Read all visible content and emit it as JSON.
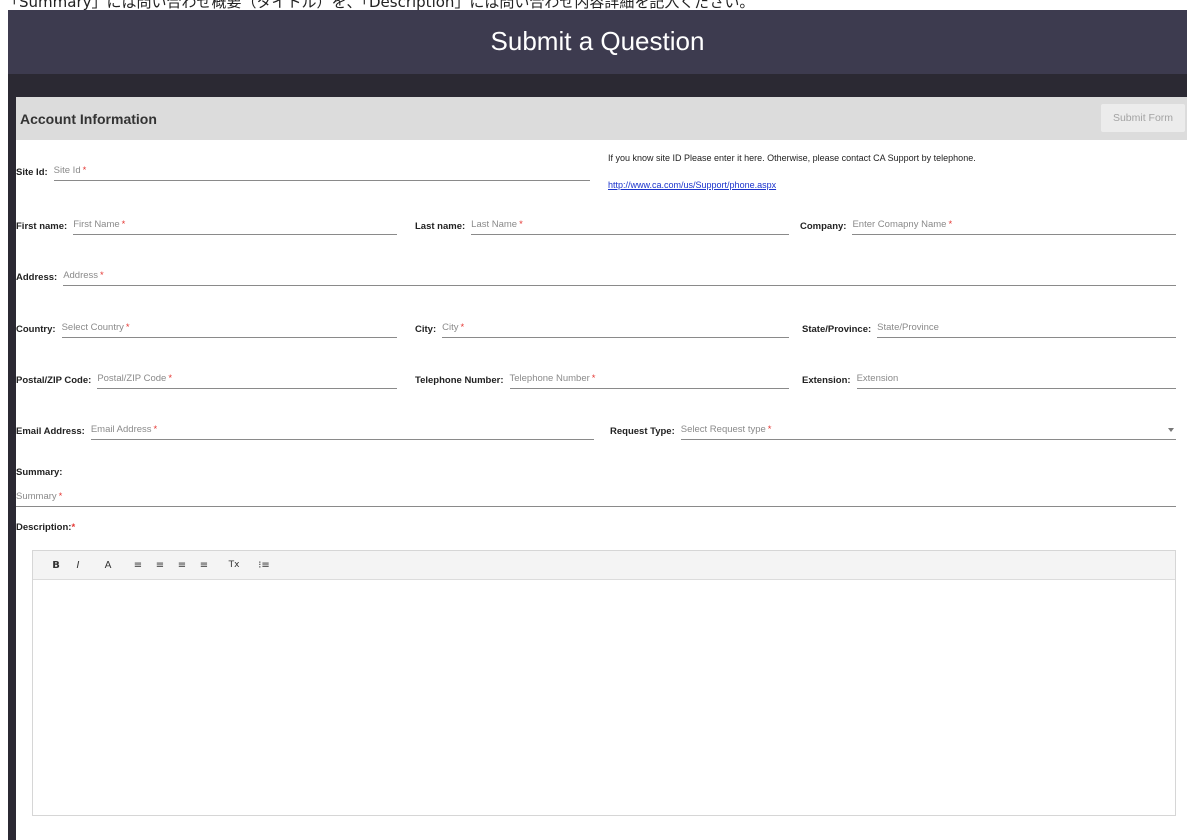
{
  "caption": "「Summary」には問い合わせ概要（タイトル）を、「Description」には問い合わせ内容詳細を記入ください。",
  "header": {
    "title": "Submit a Question"
  },
  "section": {
    "title": "Account Information",
    "submit_label": "Submit Form"
  },
  "fields": {
    "site_id": {
      "label": "Site Id:",
      "placeholder": "Site Id",
      "required": "*"
    },
    "site_info": "If you know site ID Please enter it here. Otherwise, please contact CA Support by telephone.",
    "site_link": "http://www.ca.com/us/Support/phone.aspx",
    "first_name": {
      "label": "First name:",
      "placeholder": "First Name",
      "required": "*"
    },
    "last_name": {
      "label": "Last name:",
      "placeholder": "Last Name",
      "required": "*"
    },
    "company": {
      "label": "Company:",
      "placeholder": "Enter Comapny Name",
      "required": "*"
    },
    "address": {
      "label": "Address:",
      "placeholder": "Address",
      "required": "*"
    },
    "country": {
      "label": "Country:",
      "placeholder": "Select Country",
      "required": "*"
    },
    "city": {
      "label": "City:",
      "placeholder": "City",
      "required": "*"
    },
    "state": {
      "label": "State/Province:",
      "placeholder": "State/Province"
    },
    "postal": {
      "label": "Postal/ZIP Code:",
      "placeholder": "Postal/ZIP Code",
      "required": "*"
    },
    "telephone": {
      "label": "Telephone Number:",
      "placeholder": "Telephone Number",
      "required": "*"
    },
    "extension": {
      "label": "Extension:",
      "placeholder": "Extension"
    },
    "email": {
      "label": "Email Address:",
      "placeholder": "Email Address",
      "required": "*"
    },
    "request_type": {
      "label": "Request Type:",
      "placeholder": "Select Request type",
      "required": "*"
    },
    "summary": {
      "label": "Summary:",
      "placeholder": "Summary",
      "required": "*"
    },
    "description": {
      "label": "Description:",
      "required": "*"
    }
  },
  "toolbar": {
    "bold": "B",
    "italic": "I",
    "font_color": "A",
    "align_left": "≡",
    "align_center": "≡",
    "align_right": "≡",
    "justify": "≡",
    "clear_format": "Tx",
    "list": "⁝≡"
  },
  "colors": {
    "header_bg": "#3d3b4f",
    "band_bg": "#2b2933",
    "required": "#e53935",
    "link": "#1a33cc"
  }
}
